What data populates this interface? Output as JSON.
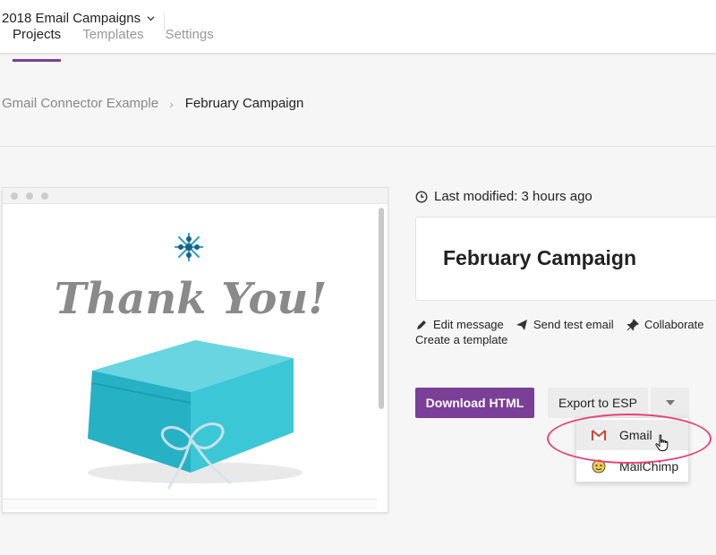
{
  "header": {
    "project_name": "2018 Email Campaigns",
    "tabs": [
      {
        "label": "Projects"
      },
      {
        "label": "Templates"
      },
      {
        "label": "Settings"
      }
    ]
  },
  "breadcrumb": {
    "parent": "Gmail Connector Example",
    "current": "February Campaign"
  },
  "preview": {
    "email_heading": "Thank You!"
  },
  "detail": {
    "last_modified": "Last modified: 3 hours ago",
    "title": "February Campaign",
    "actions": {
      "edit": "Edit message",
      "send_test": "Send test email",
      "collaborate": "Collaborate",
      "create_template": "Create a template"
    },
    "download_label": "Download HTML",
    "export_label": "Export to ESP",
    "export_menu": [
      {
        "label": "Gmail",
        "icon": "gmail-icon"
      },
      {
        "label": "MailChimp",
        "icon": "mailchimp-icon"
      }
    ]
  },
  "colors": {
    "accent": "#7b3f98",
    "highlight": "#e8437a",
    "teal": "#3fc4d4"
  }
}
